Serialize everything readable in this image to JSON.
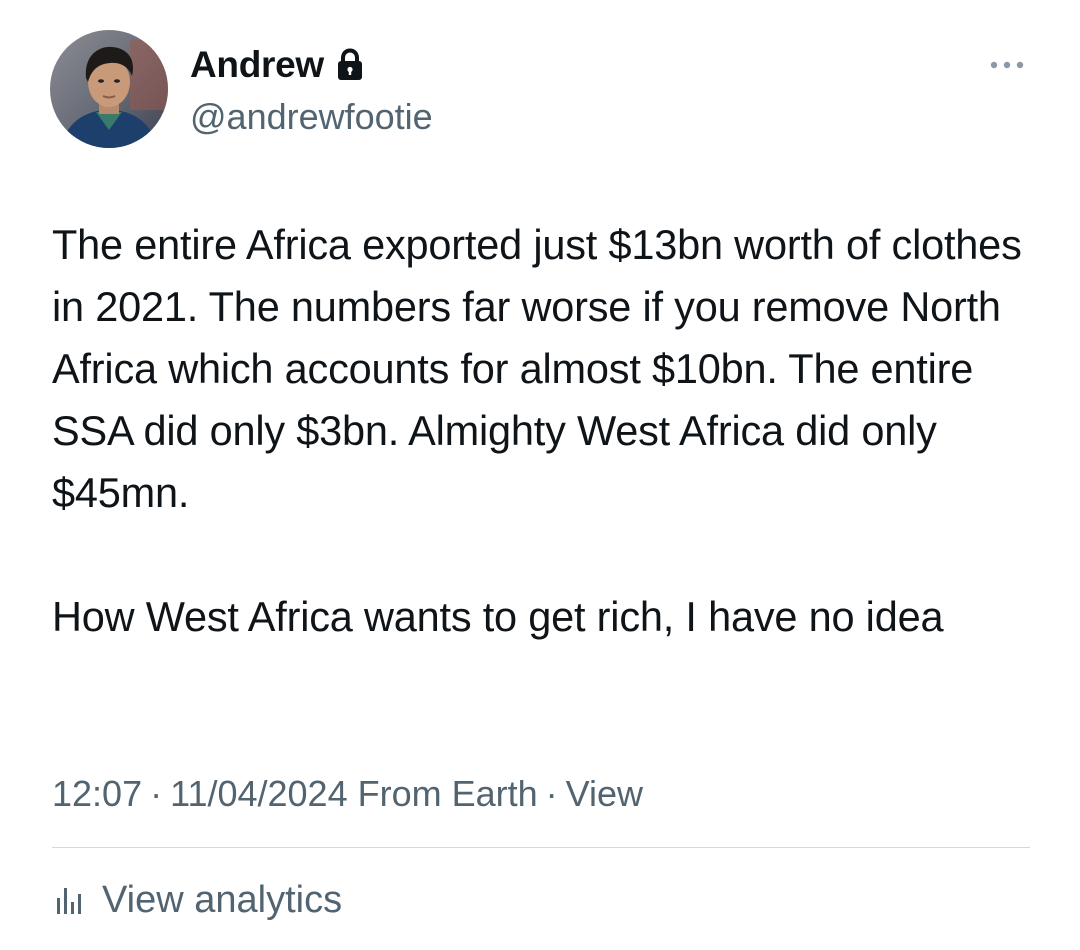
{
  "user": {
    "display_name": "Andrew",
    "handle": "@andrewfootie",
    "avatar_icon": "profile-photo",
    "protected_icon": "lock-icon"
  },
  "tweet": {
    "paragraphs": [
      "The entire Africa exported just $13bn worth of clothes in 2021. The numbers far worse if you remove North Africa which accounts for almost $10bn. The entire SSA did only $3bn. Almighty West Africa did only $45mn.",
      "How West Africa wants to get rich, I have no idea"
    ]
  },
  "meta": {
    "time": "12:07",
    "separator": "·",
    "date": "11/04/2024",
    "location": "From Earth",
    "view_label": "View"
  },
  "analytics": {
    "label": "View analytics",
    "icon": "bar-chart-icon"
  },
  "more_icon": "more-dots-icon",
  "colors": {
    "text_primary": "#0f1419",
    "text_secondary": "#536471",
    "divider": "#cfd9de"
  }
}
